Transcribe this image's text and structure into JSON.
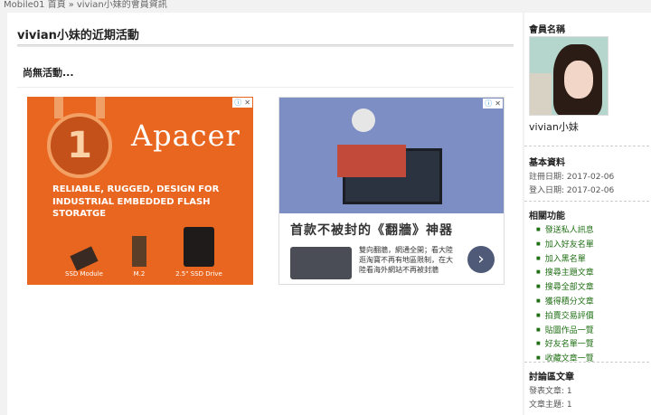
{
  "breadcrumb": {
    "home": "Mobile01 首頁",
    "separator": "»",
    "current": "vivian小妹的會員資訊"
  },
  "main": {
    "title": "vivian小妹的近期活動",
    "no_activity": "尚無活動..."
  },
  "ads": {
    "left": {
      "brand": "Apacer",
      "medal_number": "1",
      "tagline_line1": "RELIABLE, RUGGED, DESIGN FOR",
      "tagline_line2": "INDUSTRIAL EMBEDDED FLASH STORATGE",
      "products": [
        "SSD Module",
        "M.2",
        "2.5\" SSD Drive"
      ]
    },
    "right": {
      "headline": "首款不被封的《翻牆》神器",
      "description": "雙向翻牆，網通全開；看大陸逛淘寶不再有地區限制，在大陸看海外網站不再被封牆",
      "next_glyph": "›"
    },
    "adchoice_icon": "ⓘ",
    "close_icon": "✕"
  },
  "sidebar": {
    "member_heading": "會員名稱",
    "member_name": "vivian小妹",
    "basic_heading": "基本資料",
    "register_date": "註冊日期: 2017-02-06",
    "login_date": "登入日期: 2017-02-06",
    "functions_heading": "相關功能",
    "functions": [
      "發送私人訊息",
      "加入好友名單",
      "加入黑名單",
      "搜尋主題文章",
      "搜尋全部文章",
      "獲得積分文章",
      "拍賣交易評價",
      "貼圖作品一覽",
      "好友名單一覽",
      "收藏文章一覽"
    ],
    "forum_heading": "討論區文章",
    "posts": "發表文章: 1",
    "topics": "文章主題: 1"
  },
  "colors": {
    "link_green": "#1f6f14",
    "apacer_orange": "#e8661f"
  }
}
